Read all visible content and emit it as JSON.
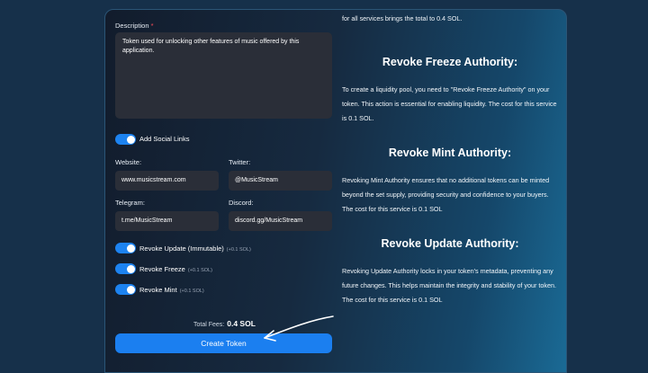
{
  "form": {
    "description_label": "Description",
    "required_mark": "*",
    "description_value": "Token used for unlocking other features of music offered by this application.",
    "social_toggle_label": "Add Social Links",
    "website_label": "Website:",
    "website_value": "www.musicstream.com",
    "twitter_label": "Twitter:",
    "twitter_value": "@MusicStream",
    "telegram_label": "Telegram:",
    "telegram_value": "t.me/MusicStream",
    "discord_label": "Discord:",
    "discord_value": "discord.gg/MusicStream",
    "revoke_update_label": "Revoke Update (Immutable)",
    "revoke_update_fee": "(+0.1 SOL)",
    "revoke_freeze_label": "Revoke Freeze",
    "revoke_freeze_fee": "(+0.1 SOL)",
    "revoke_mint_label": "Revoke Mint",
    "revoke_mint_fee": "(+0.1 SOL)",
    "total_label": "Total Fees:",
    "total_value": "0.4 SOL",
    "create_button": "Create Token"
  },
  "info": {
    "intro_text": "for all services brings the total to 0.4 SOL.",
    "freeze_heading": "Revoke Freeze Authority:",
    "freeze_text": "To create a liquidity pool, you need to \"Revoke Freeze Authority\" on your token. This action is essential for enabling liquidity. The cost for this service is 0.1 SOL.",
    "mint_heading": "Revoke Mint Authority:",
    "mint_text": "Revoking Mint Authority ensures that no additional tokens can be minted beyond the set supply, providing security and confidence to your buyers. The cost for this service is 0.1 SOL",
    "update_heading": "Revoke Update Authority:",
    "update_text": "Revoking Update Authority locks in your token's metadata, preventing any future changes. This helps maintain the integrity and stability of your token. The cost for this service is 0.1 SOL"
  },
  "colors": {
    "accent": "#1b7ff0",
    "input_bg": "#2a2e38",
    "required": "#ff4d5a"
  },
  "toggles": {
    "add_social_links": true,
    "revoke_update": true,
    "revoke_freeze": true,
    "revoke_mint": true
  }
}
